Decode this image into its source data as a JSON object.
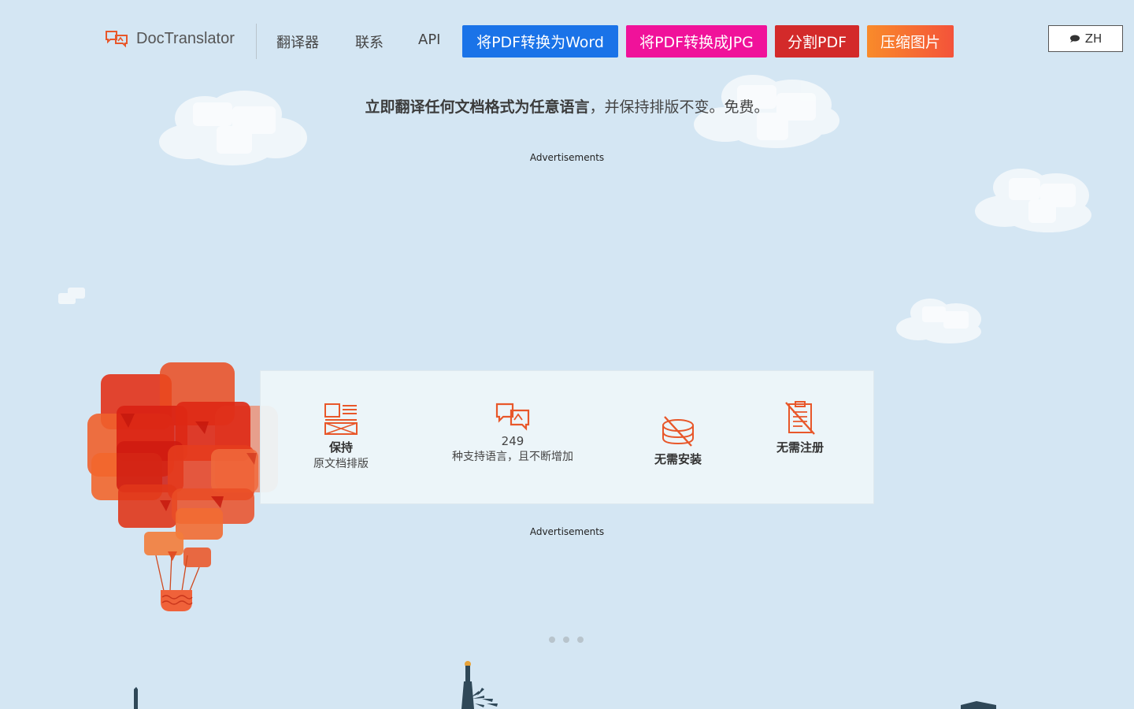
{
  "header": {
    "logo_text": "DocTranslator",
    "nav": [
      "翻译器",
      "联系",
      "API"
    ],
    "buttons": [
      {
        "label": "将PDF转换为Word",
        "color": "#1a73e8"
      },
      {
        "label": "将PDF转换成JPG",
        "color": "#f0129a"
      },
      {
        "label": "分割PDF",
        "color": "#d32a2a"
      },
      {
        "label": "压缩图片",
        "color": "#f7672a"
      }
    ],
    "language": "ZH"
  },
  "tagline": {
    "bold": "立即翻译任何文档格式为任意语言",
    "rest": "，并保持排版不变。免费。"
  },
  "ads": {
    "top": "Advertisements",
    "bottom": "Advertisements"
  },
  "features": [
    {
      "icon": "layout-icon",
      "title": "保持",
      "subtitle": "原文档排版"
    },
    {
      "icon": "translate-bubbles-icon",
      "title": "249",
      "subtitle": "种支持语言，且不断增加"
    },
    {
      "icon": "no-install-icon",
      "title": "无需安装",
      "subtitle": ""
    },
    {
      "icon": "no-register-icon",
      "title": "无需注册",
      "subtitle": ""
    }
  ],
  "colors": {
    "background": "#d4e6f3",
    "accent": "#e8572a"
  }
}
